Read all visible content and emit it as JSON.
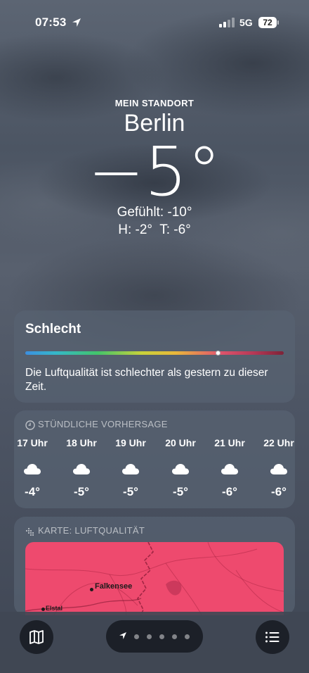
{
  "status_bar": {
    "time": "07:53",
    "network": "5G",
    "battery": "72"
  },
  "header": {
    "location_label": "MEIN STANDORT",
    "city": "Berlin",
    "temperature": "−5°",
    "feels_like": "Gefühlt: -10°",
    "high_low": "H: -2°  T: -6°"
  },
  "air_quality": {
    "title": "Schlecht",
    "level": 0.745,
    "description": "Die Luftqualität ist schlechter als gestern zu dieser Zeit."
  },
  "hourly": {
    "header": "STÜNDLICHE VORHERSAGE",
    "hours": [
      {
        "time": "17 Uhr",
        "temp": "-4°",
        "icon": "cloud-icon"
      },
      {
        "time": "18 Uhr",
        "temp": "-5°",
        "icon": "cloud-icon"
      },
      {
        "time": "19 Uhr",
        "temp": "-5°",
        "icon": "cloud-icon"
      },
      {
        "time": "20 Uhr",
        "temp": "-5°",
        "icon": "cloud-icon"
      },
      {
        "time": "21 Uhr",
        "temp": "-6°",
        "icon": "cloud-icon"
      },
      {
        "time": "22 Uhr",
        "temp": "-6°",
        "icon": "cloud-icon"
      }
    ]
  },
  "map_card": {
    "header": "KARTE: LUFTQUALITÄT",
    "places": [
      "Falkensee",
      "Elstal"
    ]
  },
  "toolbar": {
    "map_icon": "map-icon",
    "list_icon": "list-icon",
    "page_count": 6,
    "current_page": 1
  },
  "colors": {
    "map_fill": "#ee4a6e",
    "card_bg": "#586271"
  }
}
